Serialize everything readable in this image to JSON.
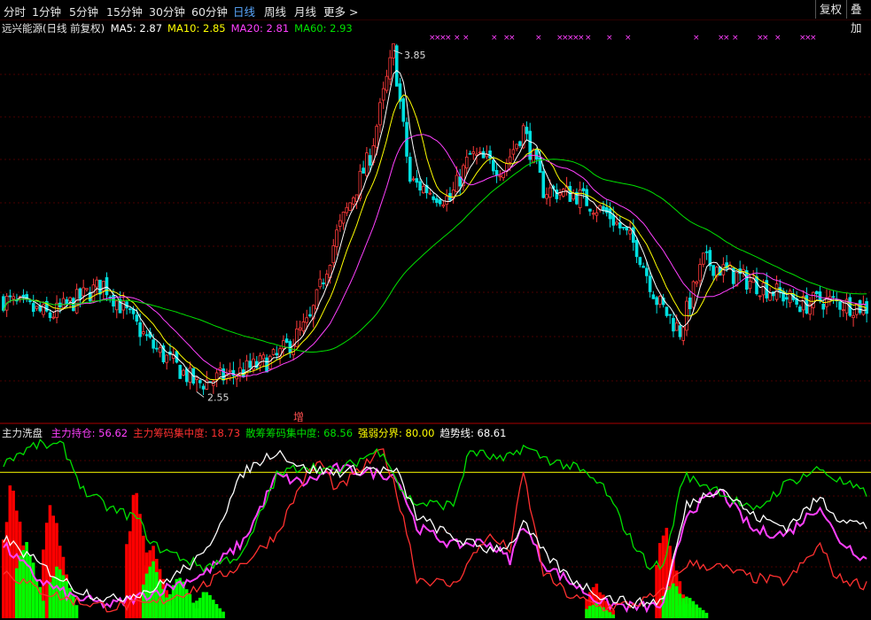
{
  "toolbar": {
    "tabs": [
      {
        "label": "分时",
        "active": false
      },
      {
        "label": "1分钟",
        "active": false
      },
      {
        "label": "5分钟",
        "active": false
      },
      {
        "label": "15分钟",
        "active": false
      },
      {
        "label": "30分钟",
        "active": false
      },
      {
        "label": "60分钟",
        "active": false
      },
      {
        "label": "日线",
        "active": true
      },
      {
        "label": "周线",
        "active": false
      },
      {
        "label": "月线",
        "active": false
      },
      {
        "label": "更多 >",
        "active": false
      }
    ],
    "fuquan_label": "复权",
    "overlay_label": "叠加"
  },
  "main": {
    "title": "远兴能源(日线 前复权)",
    "ma": [
      {
        "label": "MA5: 2.87",
        "color": "#ffffff"
      },
      {
        "label": "MA10: 2.85",
        "color": "#ffff00"
      },
      {
        "label": "MA20: 2.81",
        "color": "#ff40ff"
      },
      {
        "label": "MA60: 2.93",
        "color": "#00e000"
      }
    ],
    "high_label": "3.85",
    "low_label": "2.55",
    "marker_label": "增"
  },
  "sub": {
    "title": "主力洗盘",
    "items": [
      {
        "label": "主力持仓: 56.62",
        "color": "#ff40ff"
      },
      {
        "label": "主力筹码集中度: 18.73",
        "color": "#ff3030"
      },
      {
        "label": "散筹筹码集中度: 68.56",
        "color": "#00e000"
      },
      {
        "label": "强弱分界: 80.00",
        "color": "#ffff00"
      },
      {
        "label": "趋势线: 68.61",
        "color": "#ffffff"
      }
    ]
  },
  "chart_data": [
    {
      "type": "candlestick",
      "title": "远兴能源(日线 前复权)",
      "ylim": [
        2.45,
        3.9
      ],
      "keypoints": [
        [
          0,
          2.9
        ],
        [
          14,
          2.84
        ],
        [
          30,
          2.96
        ],
        [
          45,
          2.72
        ],
        [
          58,
          2.58
        ],
        [
          70,
          2.62
        ],
        [
          82,
          2.68
        ],
        [
          92,
          2.82
        ],
        [
          100,
          3.15
        ],
        [
          110,
          3.45
        ],
        [
          117,
          3.85
        ],
        [
          122,
          3.35
        ],
        [
          134,
          3.28
        ],
        [
          140,
          3.45
        ],
        [
          150,
          3.4
        ],
        [
          156,
          3.55
        ],
        [
          162,
          3.32
        ],
        [
          172,
          3.3
        ],
        [
          182,
          3.22
        ],
        [
          190,
          3.1
        ],
        [
          196,
          2.9
        ],
        [
          203,
          2.78
        ],
        [
          210,
          3.05
        ],
        [
          218,
          3.0
        ],
        [
          228,
          2.95
        ],
        [
          240,
          2.88
        ],
        [
          245,
          2.9
        ],
        [
          259,
          2.87
        ]
      ],
      "bars": 260,
      "annotations": {
        "max": 3.85,
        "min": 2.55
      },
      "series": [
        {
          "name": "MA5",
          "color": "#ffffff",
          "last": 2.87
        },
        {
          "name": "MA10",
          "color": "#ffff00",
          "last": 2.85
        },
        {
          "name": "MA20",
          "color": "#ff40ff",
          "last": 2.81
        },
        {
          "name": "MA60",
          "color": "#00e000",
          "last": 2.93
        }
      ]
    },
    {
      "type": "line",
      "title": "主力洗盘",
      "ylim": [
        0,
        100
      ],
      "reference_line": 80,
      "series": [
        {
          "name": "主力持仓",
          "color": "#ff40ff",
          "last": 56.62,
          "keypoints": [
            [
              0,
              40
            ],
            [
              10,
              22
            ],
            [
              20,
              12
            ],
            [
              32,
              7
            ],
            [
              45,
              14
            ],
            [
              60,
              24
            ],
            [
              72,
              42
            ],
            [
              82,
              78
            ],
            [
              90,
              74
            ],
            [
              100,
              82
            ],
            [
              110,
              80
            ],
            [
              118,
              78
            ],
            [
              124,
              50
            ],
            [
              135,
              40
            ],
            [
              145,
              42
            ],
            [
              152,
              32
            ],
            [
              156,
              52
            ],
            [
              162,
              30
            ],
            [
              170,
              20
            ],
            [
              180,
              8
            ],
            [
              190,
              6
            ],
            [
              198,
              7
            ],
            [
              205,
              58
            ],
            [
              215,
              70
            ],
            [
              225,
              48
            ],
            [
              235,
              46
            ],
            [
              245,
              62
            ],
            [
              250,
              44
            ],
            [
              259,
              32
            ]
          ]
        },
        {
          "name": "主力筹码集中度",
          "color": "#ff3030",
          "last": 18.73,
          "keypoints": [
            [
              0,
              26
            ],
            [
              10,
              16
            ],
            [
              20,
              10
            ],
            [
              32,
              6
            ],
            [
              45,
              8
            ],
            [
              60,
              18
            ],
            [
              72,
              30
            ],
            [
              82,
              46
            ],
            [
              90,
              76
            ],
            [
              95,
              86
            ],
            [
              100,
              70
            ],
            [
              110,
              86
            ],
            [
              114,
              92
            ],
            [
              120,
              56
            ],
            [
              124,
              22
            ],
            [
              135,
              18
            ],
            [
              145,
              45
            ],
            [
              152,
              38
            ],
            [
              156,
              80
            ],
            [
              162,
              25
            ],
            [
              170,
              12
            ],
            [
              180,
              6
            ],
            [
              190,
              8
            ],
            [
              198,
              14
            ],
            [
              205,
              30
            ],
            [
              215,
              28
            ],
            [
              225,
              22
            ],
            [
              235,
              20
            ],
            [
              245,
              40
            ],
            [
              250,
              22
            ],
            [
              259,
              18
            ]
          ]
        },
        {
          "name": "散筹筹码集中度",
          "color": "#00e000",
          "last": 68.56,
          "keypoints": [
            [
              0,
              86
            ],
            [
              10,
              95
            ],
            [
              18,
              94
            ],
            [
              24,
              70
            ],
            [
              32,
              60
            ],
            [
              40,
              55
            ],
            [
              45,
              40
            ],
            [
              60,
              28
            ],
            [
              72,
              35
            ],
            [
              82,
              78
            ],
            [
              90,
              84
            ],
            [
              100,
              80
            ],
            [
              110,
              90
            ],
            [
              114,
              92
            ],
            [
              120,
              68
            ],
            [
              124,
              63
            ],
            [
              135,
              62
            ],
            [
              140,
              92
            ],
            [
              150,
              86
            ],
            [
              156,
              94
            ],
            [
              162,
              88
            ],
            [
              172,
              82
            ],
            [
              180,
              72
            ],
            [
              188,
              44
            ],
            [
              193,
              30
            ],
            [
              198,
              28
            ],
            [
              204,
              78
            ],
            [
              215,
              70
            ],
            [
              225,
              58
            ],
            [
              235,
              74
            ],
            [
              245,
              82
            ],
            [
              250,
              76
            ],
            [
              259,
              68
            ]
          ]
        },
        {
          "name": "趋势线",
          "color": "#ffffff",
          "last": 68.61,
          "keypoints": [
            [
              0,
              44
            ],
            [
              12,
              28
            ],
            [
              22,
              16
            ],
            [
              32,
              10
            ],
            [
              45,
              16
            ],
            [
              60,
              34
            ],
            [
              72,
              80
            ],
            [
              82,
              92
            ],
            [
              90,
              82
            ],
            [
              100,
              80
            ],
            [
              110,
              82
            ],
            [
              118,
              80
            ],
            [
              124,
              56
            ],
            [
              135,
              44
            ],
            [
              145,
              38
            ],
            [
              152,
              40
            ],
            [
              156,
              52
            ],
            [
              162,
              36
            ],
            [
              170,
              22
            ],
            [
              180,
              12
            ],
            [
              190,
              8
            ],
            [
              198,
              10
            ],
            [
              205,
              62
            ],
            [
              215,
              72
            ],
            [
              225,
              56
            ],
            [
              235,
              50
            ],
            [
              245,
              66
            ],
            [
              250,
              56
            ],
            [
              259,
              50
            ]
          ]
        }
      ],
      "bars": {
        "name": "主力洗盘柱",
        "colors": [
          "#ff0000",
          "#00ff00"
        ],
        "red_clusters": [
          [
            0,
            88
          ],
          [
            12,
            76
          ],
          [
            37,
            80
          ],
          [
            42,
            46
          ],
          [
            175,
            22
          ],
          [
            196,
            62
          ],
          [
            200,
            18
          ]
        ],
        "green_clusters": [
          [
            4,
            50
          ],
          [
            14,
            36
          ],
          [
            42,
            36
          ],
          [
            50,
            28
          ],
          [
            58,
            18
          ],
          [
            175,
            10
          ],
          [
            198,
            24
          ],
          [
            203,
            14
          ]
        ]
      }
    }
  ]
}
